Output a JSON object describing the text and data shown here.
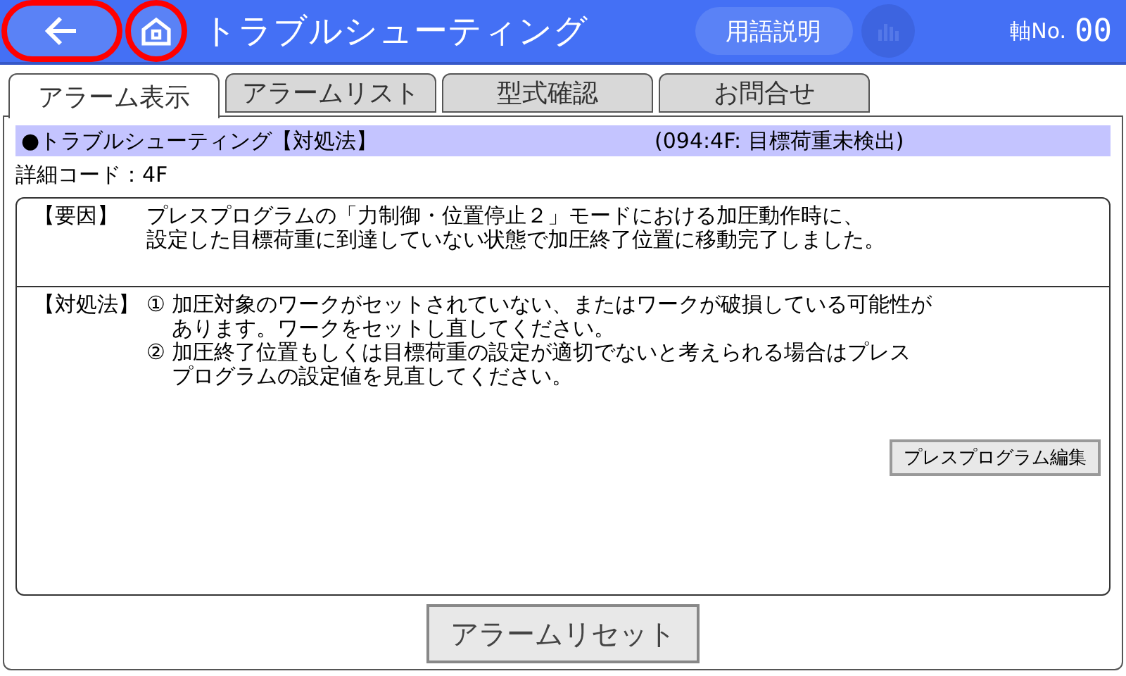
{
  "header": {
    "back_button": {
      "highlighted": true
    },
    "home_button": {
      "highlighted": true
    },
    "title": "トラブルシューティング",
    "glossary_button": "用語説明",
    "chart_button": {
      "disabled": true
    },
    "axis_label": "軸No.",
    "axis_value": "00"
  },
  "tabs": [
    {
      "label": "アラーム表示",
      "selected": true
    },
    {
      "label": "アラームリスト",
      "selected": false
    },
    {
      "label": "型式確認",
      "selected": false
    },
    {
      "label": "お問合せ",
      "selected": false
    }
  ],
  "heading": {
    "title": "●トラブルシューティング【対処法】",
    "code_info": "(094:4F: 目標荷重未検出)"
  },
  "detail_code": "詳細コード：4F",
  "cause": {
    "label": "【要因】",
    "lines": [
      "プレスプログラムの「力制御・位置停止２」モードにおける加圧動作時に、",
      "設定した目標荷重に到達していない状態で加圧終了位置に移動完了しました。"
    ]
  },
  "remedy": {
    "label": "【対処法】",
    "items": [
      {
        "mark": "①",
        "lines": [
          "加圧対象のワークがセットされていない、またはワークが破損している可能性が",
          "あります。ワークをセットし直してください。"
        ]
      },
      {
        "mark": "②",
        "lines": [
          "加圧終了位置もしくは目標荷重の設定が適切でないと考えられる場合はプレス",
          "プログラムの設定値を見直してください。"
        ]
      }
    ],
    "button": "プレスプログラム編集"
  },
  "reset_button": "アラームリセット"
}
